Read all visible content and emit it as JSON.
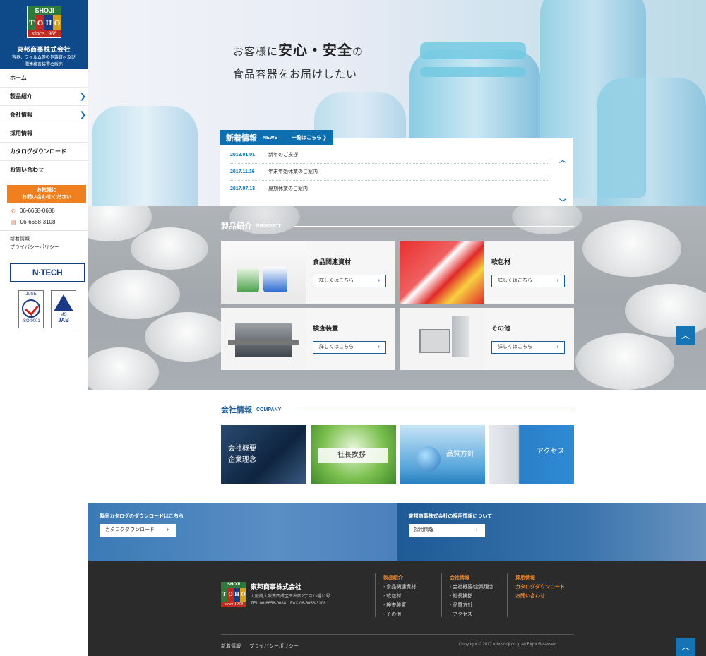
{
  "brand": {
    "logo_top": "SHOJI",
    "logo_mid": [
      "T",
      "O",
      "H",
      "O"
    ],
    "logo_bottom": "since 1968",
    "company_name": "東邦商事株式会社",
    "description_line1": "容器、フィルム等の包装資材及び",
    "description_line2": "関連検査装置の販売"
  },
  "nav": {
    "items": [
      {
        "label": "ホーム",
        "has_submenu": false
      },
      {
        "label": "製品紹介",
        "has_submenu": true
      },
      {
        "label": "会社情報",
        "has_submenu": true
      },
      {
        "label": "採用情報",
        "has_submenu": false
      },
      {
        "label": "カタログダウンロード",
        "has_submenu": false
      },
      {
        "label": "お問い合わせ",
        "has_submenu": false
      }
    ],
    "contact_line1": "お気軽に",
    "contact_line2": "お問い合わせください",
    "tel": "06-6658-0688",
    "fax": "06-6658-3108",
    "links": [
      "新着情報",
      "プライバシーポリシー"
    ],
    "partner_logo": "N·TECH",
    "cert1_top": "JUSE",
    "cert1_bottom": "ISO 9001",
    "cert2_top": "MS",
    "cert2_bottom": "JAB"
  },
  "hero": {
    "line1_pre": "お客様に",
    "line1_em": "安心・安全",
    "line1_post": "の",
    "line2": "食品容器をお届けしたい"
  },
  "news": {
    "title": "新着情報",
    "title_en": "NEWS",
    "more": "一覧はこちら ❯",
    "items": [
      {
        "date": "2018.01.01",
        "text": "新年のご挨拶"
      },
      {
        "date": "2017.11.16",
        "text": "年末年始休業のご案内"
      },
      {
        "date": "2017.07.13",
        "text": "夏期休業のご案内"
      }
    ]
  },
  "products": {
    "title": "製品紹介",
    "title_en": "PRODUCT",
    "button": "詳しくはこちら",
    "items": [
      {
        "name": "食品関連資材"
      },
      {
        "name": "軟包材"
      },
      {
        "name": "検査装置"
      },
      {
        "name": "その他"
      }
    ]
  },
  "company": {
    "title": "会社情報",
    "title_en": "COMPANY",
    "cards": [
      {
        "line1": "会社概要",
        "line2": "企業理念"
      },
      {
        "line1": "社長挨拶",
        "line2": ""
      },
      {
        "line1": "品質方針",
        "line2": ""
      },
      {
        "line1": "アクセス",
        "line2": ""
      }
    ]
  },
  "banners": {
    "catalog_title": "製品カタログのダウンロードはこちら",
    "catalog_button": "カタログダウンロード",
    "recruit_title": "東邦商事株式会社の採用情報について",
    "recruit_button": "採用情報"
  },
  "footer": {
    "company_name": "東邦商事株式会社",
    "address": "大阪府大阪市西成区玉出西2丁目13番21号",
    "tel_fax": "TEL.06-6658-0688　FAX.06-6658-3108",
    "col1_title": "製品紹介",
    "col1_items": [
      "- 食品関連資材",
      "- 軟包材",
      "- 検査装置",
      "- その他"
    ],
    "col2_title": "会社情報",
    "col2_items": [
      "- 会社概要/企業理念",
      "- 社長挨拶",
      "- 品質方針",
      "- アクセス"
    ],
    "col3_items": [
      "採用情報",
      "カタログダウンロード",
      "お問い合わせ"
    ],
    "bottom_links": [
      "新着情報",
      "プライバシーポリシー"
    ],
    "copyright": "Copyright © 2017 tohoshoji.co.jp All Right Reserved."
  },
  "colors": {
    "primary": "#0e6fb0",
    "accent": "#f0801f",
    "footer_bg": "#2b2b2b"
  },
  "icons": {
    "scroll_top": "chevron-up-icon",
    "nav_chevron": "chevron-right-icon"
  }
}
